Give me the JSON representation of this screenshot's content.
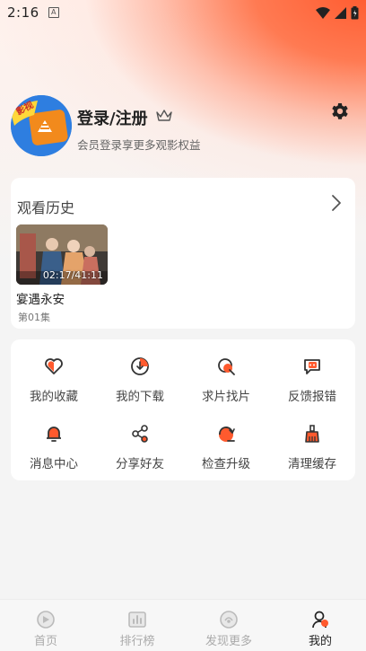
{
  "status_bar": {
    "time": "2:16",
    "notification_glyph": "A",
    "battery_level": "full"
  },
  "profile": {
    "title": "登录/注册",
    "subtitle": "会员登录享更多观影权益",
    "avatar_badge": "影视"
  },
  "history": {
    "title": "观看历史",
    "items": [
      {
        "name": "宴遇永安",
        "episode": "第01集",
        "progress_time": "02:17/41:11"
      }
    ]
  },
  "menu": {
    "items": [
      {
        "label": "我的收藏",
        "icon": "heart-icon"
      },
      {
        "label": "我的下载",
        "icon": "download-icon"
      },
      {
        "label": "求片找片",
        "icon": "search-film-icon"
      },
      {
        "label": "反馈报错",
        "icon": "feedback-icon"
      },
      {
        "label": "消息中心",
        "icon": "bell-icon"
      },
      {
        "label": "分享好友",
        "icon": "share-icon"
      },
      {
        "label": "检查升级",
        "icon": "upgrade-icon"
      },
      {
        "label": "清理缓存",
        "icon": "clean-icon"
      }
    ]
  },
  "tabbar": {
    "tabs": [
      {
        "label": "首页",
        "icon": "home-icon",
        "active": false
      },
      {
        "label": "排行榜",
        "icon": "ranking-icon",
        "active": false
      },
      {
        "label": "发现更多",
        "icon": "discover-icon",
        "active": false
      },
      {
        "label": "我的",
        "icon": "profile-icon",
        "active": true
      }
    ]
  },
  "colors": {
    "accent": "#ff5a2e",
    "icon_line": "#444444",
    "tab_inactive": "#aaaaaa"
  }
}
